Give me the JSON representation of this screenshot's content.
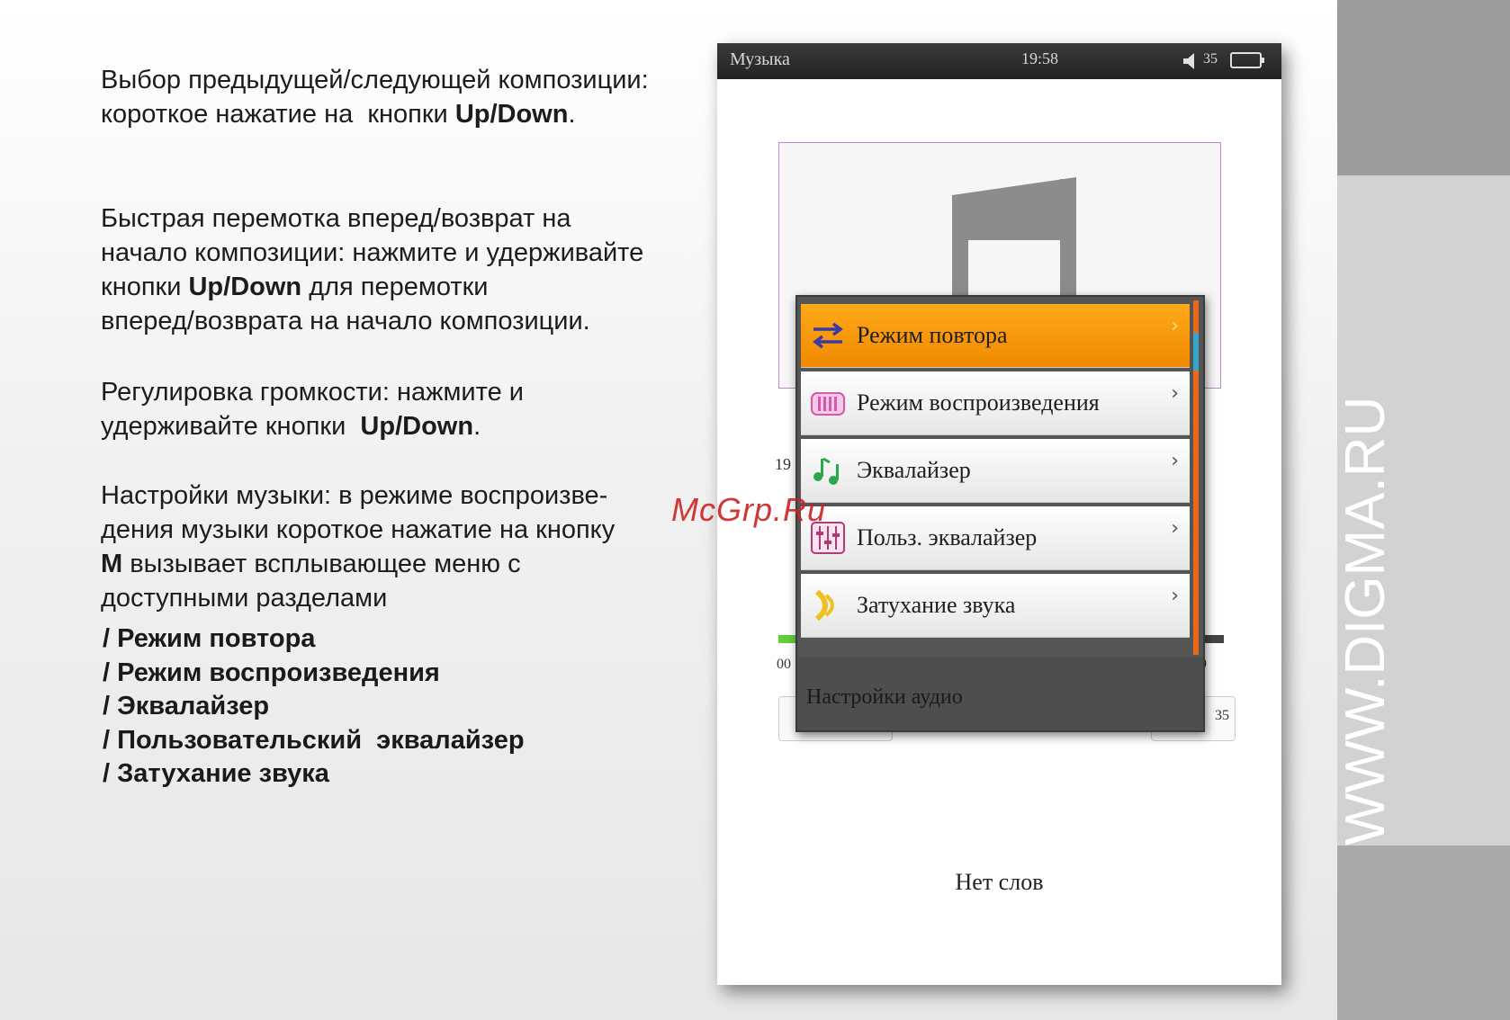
{
  "instructions": {
    "p1_line1": "Выбор предыдущей/следующей композиции:",
    "p1_line2_pre": "короткое нажатие на  кнопки ",
    "p1_line2_bold": "Up/Down",
    "p1_line2_post": ".",
    "p2_line1": "Быстрая перемотка вперед/возврат на",
    "p2_line2": "начало композиции: нажмите и удерживайте",
    "p2_line3_pre": "кнопки ",
    "p2_line3_bold": "Up/Down",
    "p2_line3_post": " для перемотки",
    "p2_line4": "вперед/возврата на начало композиции.",
    "p3_line1": "Регулировка громкости: нажмите и",
    "p3_line2_pre": "удерживайте кнопки  ",
    "p3_line2_bold": "Up/Down",
    "p3_line2_post": ".",
    "p4_line1": "Настройки музыки: в режиме воспроизве-",
    "p4_line2": "дения музыки короткое нажатие на кнопку",
    "p4_line3_bold": "M",
    "p4_line3_post": " вызывает всплывающее меню с",
    "p4_line4": "доступными разделами",
    "sections": [
      "/ Режим повтора",
      "/ Режим воспроизведения",
      "/ Эквалайзер",
      "/ Пользовательский  эквалайзер",
      "/ Затухание звука"
    ]
  },
  "watermark": "McGrp.Ru",
  "side_url": "WWW.DIGMA.RU",
  "device": {
    "status": {
      "app_title": "Музыка",
      "time": "19:58",
      "volume": "35",
      "battery_icon": "battery-icon",
      "speaker_icon": "speaker-icon"
    },
    "fragments": {
      "left_number": "19",
      "time_left": "00",
      "time_right": "9",
      "button_right": "35"
    },
    "menu": {
      "items": [
        {
          "label": "Режим повтора",
          "icon": "repeat-icon",
          "selected": true
        },
        {
          "label": "Режим воспроизведения",
          "icon": "playmode-icon",
          "selected": false
        },
        {
          "label": "Эквалайзер",
          "icon": "music-notes-icon",
          "selected": false
        },
        {
          "label": "Польз. эквалайзер",
          "icon": "custom-eq-icon",
          "selected": false
        },
        {
          "label": "Затухание звука",
          "icon": "fade-icon",
          "selected": false
        }
      ],
      "footer": "Настройки аудио",
      "chevron": "›"
    },
    "no_lyrics": "Нет слов",
    "colors": {
      "selected": "#f39a0a",
      "progress": "#5fcf3a",
      "scroll_track": "#e86a1a",
      "scroll_thumb": "#3aa3c8"
    }
  }
}
